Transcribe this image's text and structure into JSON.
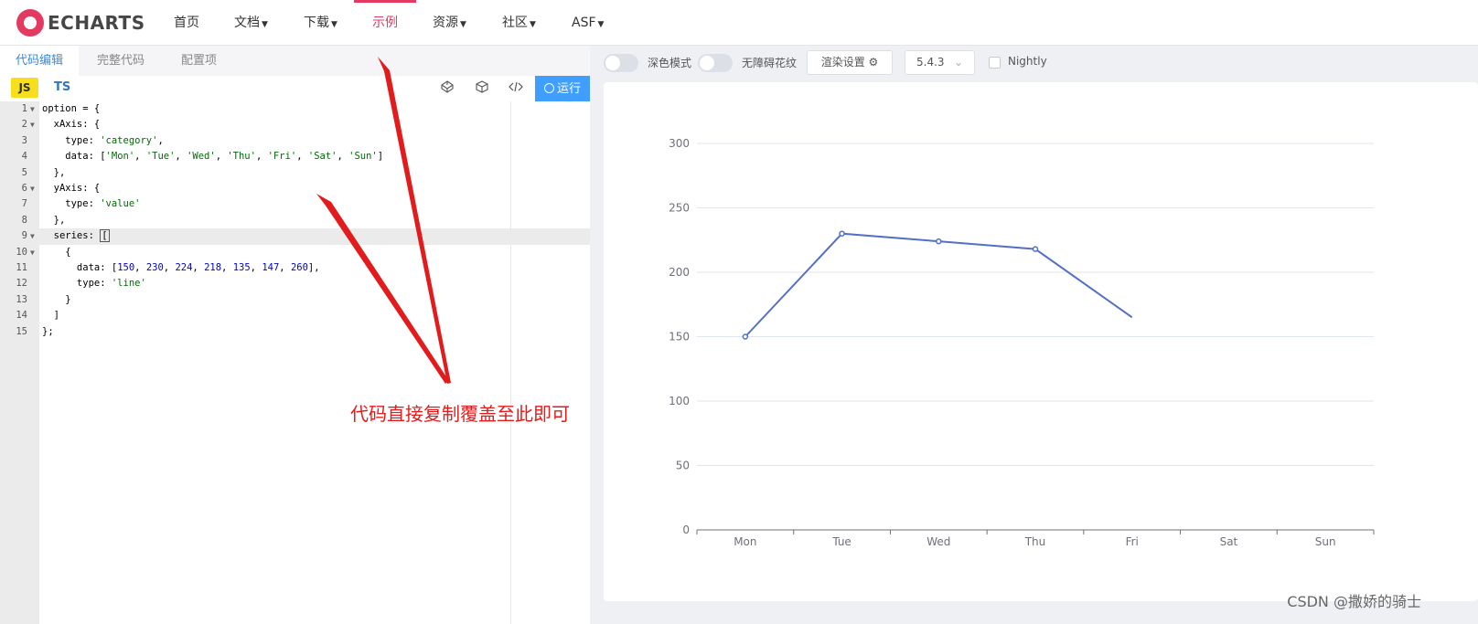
{
  "nav": {
    "logo": "ECHARTS",
    "items": [
      {
        "label": "首页",
        "caret": false
      },
      {
        "label": "文档",
        "caret": true
      },
      {
        "label": "下载",
        "caret": true
      },
      {
        "label": "示例",
        "caret": false
      },
      {
        "label": "资源",
        "caret": true
      },
      {
        "label": "社区",
        "caret": true
      },
      {
        "label": "ASF",
        "caret": true
      }
    ]
  },
  "editor": {
    "tabs": [
      "代码编辑",
      "完整代码",
      "配置项"
    ],
    "lang_js": "JS",
    "lang_ts": "TS",
    "run_label": "运行"
  },
  "preview": {
    "dark_mode_label": "深色模式",
    "aria_label": "无障碍花纹",
    "render_settings_label": "渲染设置",
    "version": "5.4.3",
    "nightly_label": "Nightly"
  },
  "annotation": "代码直接复制覆盖至此即可",
  "watermark": "CSDN @撒娇的骑士",
  "colors": {
    "brand": "#e43961",
    "accent": "#409eff",
    "series": "#5470c6",
    "annotation": "#e21c1c"
  },
  "chart_data": {
    "type": "line",
    "categories": [
      "Mon",
      "Tue",
      "Wed",
      "Thu",
      "Fri",
      "Sat",
      "Sun"
    ],
    "series": [
      {
        "values": [
          150,
          230,
          224,
          218,
          165
        ]
      }
    ],
    "ylim": [
      0,
      300
    ],
    "yticks": [
      0,
      50,
      100,
      150,
      200,
      250,
      300
    ],
    "grid": true,
    "title": "",
    "xlabel": "",
    "ylabel": ""
  }
}
